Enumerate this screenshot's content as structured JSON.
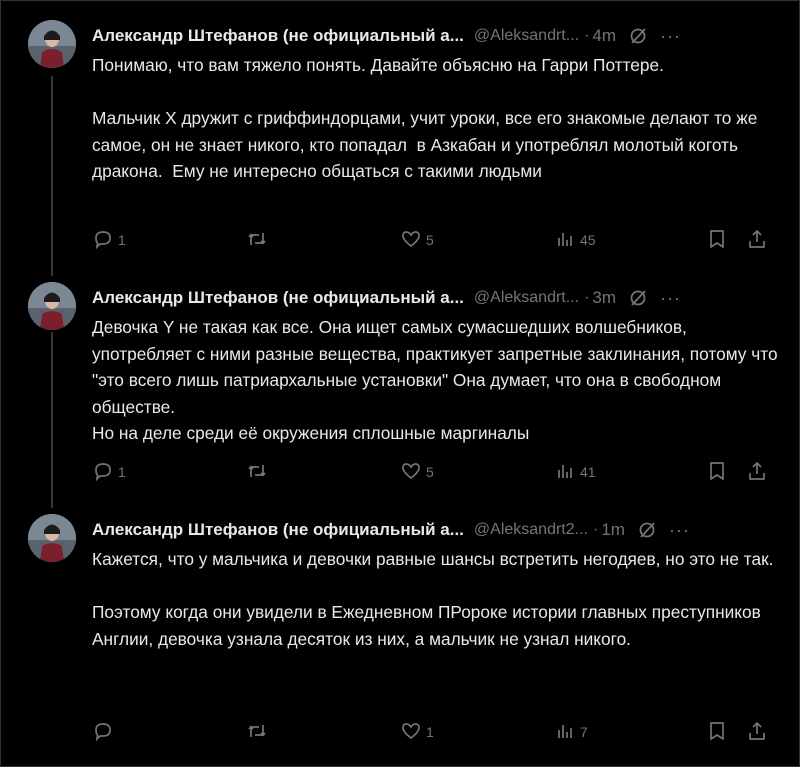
{
  "tweets": [
    {
      "author_name": "Александр Штефанов (не официальный а...",
      "handle": "@Aleksandrt...",
      "separator": "·",
      "time": "4m",
      "text": "Понимаю, что вам тяжело понять. Давайте объясню на Гарри Поттере.\n\nМальчик Х дружит с гриффиндорцами, учит уроки, все его знакомые делают то же самое, он не знает никого, кто попадал  в Азкабан и употреблял молотый коготь дракона.  Ему не интересно общаться с такими людьми",
      "replies": "1",
      "reposts": "",
      "likes": "5",
      "views": "45"
    },
    {
      "author_name": "Александр Штефанов (не официальный а...",
      "handle": "@Aleksandrt...",
      "separator": "·",
      "time": "3m",
      "text": "Девочка Y не такая как все. Она ищет самых сумасшедших волшебников, употребляет с ними разные вещества, практикует запретные заклинания, потому что \"это всего лишь патриархальные установки\" Она думает, что она в свободном обществе.\nНо на деле среди её окружения сплошные маргиналы",
      "replies": "1",
      "reposts": "",
      "likes": "5",
      "views": "41"
    },
    {
      "author_name": "Александр Штефанов (не официальный а...",
      "handle": "@Aleksandrt2...",
      "separator": "·",
      "time": "1m",
      "text": "Кажется, что у мальчика и девочки равные шансы встретить негодяев, но это не так.\n\nПоэтому когда они увидели в Ежедневном ПРороке истории главных преступников Англии, девочка узнала десяток из них, а мальчик не узнал никого.",
      "replies": "",
      "reposts": "",
      "likes": "1",
      "views": "7"
    }
  ],
  "more_label": "···",
  "icons": [
    "reply-icon",
    "repost-icon",
    "like-icon",
    "views-icon",
    "bookmark-icon",
    "share-icon",
    "grok-icon",
    "more-icon"
  ],
  "colors": {
    "background": "#000000",
    "text": "#e7e9ea",
    "muted": "#71767b",
    "thread_line": "#333639"
  }
}
